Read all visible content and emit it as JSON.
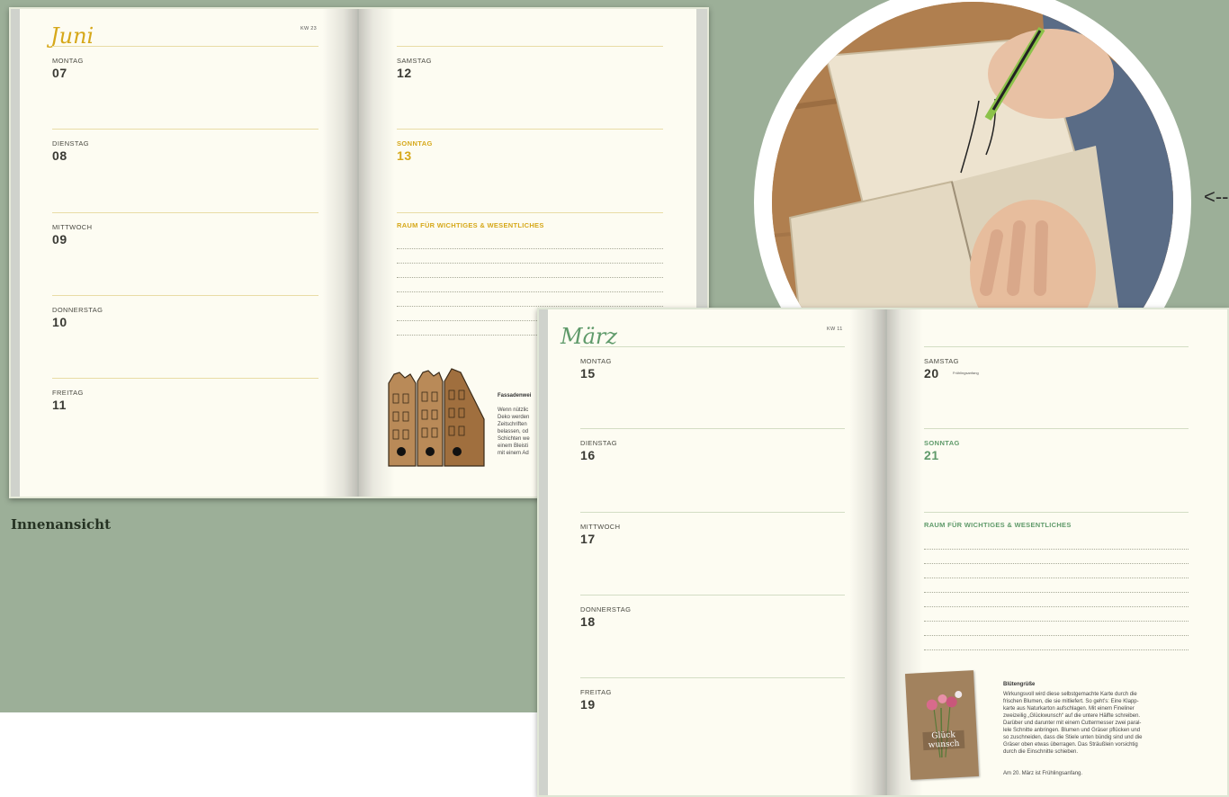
{
  "caption": "Innenansicht",
  "arrow_glyph": "<--",
  "dash_glyph": "---",
  "spread_june": {
    "month_script": "Juni",
    "kw": "KW 23",
    "left_days": [
      {
        "weekday": "MONTAG",
        "day": "07"
      },
      {
        "weekday": "DIENSTAG",
        "day": "08"
      },
      {
        "weekday": "MITTWOCH",
        "day": "09"
      },
      {
        "weekday": "DONNERSTAG",
        "day": "10"
      },
      {
        "weekday": "FREITAG",
        "day": "11"
      }
    ],
    "saturday": {
      "weekday": "SAMSTAG",
      "day": "12"
    },
    "sunday": {
      "weekday": "SONNTAG",
      "day": "13"
    },
    "raum_label": "RAUM FÜR WICHTIGES & WESENTLICHES",
    "tip_title": "Fassadenwei",
    "tip_lines": [
      "Wenn nützlic",
      "Deko werden",
      "Zeitschriften",
      "belassen, od",
      "Schichten we",
      "einem Bleisti",
      "mit einem Ad"
    ],
    "accent_color": "#d6a81a"
  },
  "spread_march": {
    "month_script": "März",
    "kw": "KW 11",
    "left_days": [
      {
        "weekday": "MONTAG",
        "day": "15"
      },
      {
        "weekday": "DIENSTAG",
        "day": "16"
      },
      {
        "weekday": "MITTWOCH",
        "day": "17"
      },
      {
        "weekday": "DONNERSTAG",
        "day": "18"
      },
      {
        "weekday": "FREITAG",
        "day": "19"
      }
    ],
    "saturday": {
      "weekday": "SAMSTAG",
      "day": "20",
      "note": "Frühlingsanfang"
    },
    "sunday": {
      "weekday": "SONNTAG",
      "day": "21"
    },
    "raum_label": "RAUM FÜR WICHTIGES & WESENTLICHES",
    "tip_title": "Blütengrüße",
    "tip_lines": [
      "Wirkungsvoll wird diese selbstgemachte Karte durch die",
      "frischen Blumen, die sie mitliefert. So geht’s: Eine Klapp-",
      "karte aus Naturkarton aufschlagen. Mit einem Fineliner",
      "zweizeilig „Glückwunsch“ auf die untere Hälfte schreiben.",
      "Darüber und darunter mit einem Cuttermesser zwei paral-",
      "lele Schnitte anbringen. Blumen und Gräser pflücken und",
      "so zuschneiden, dass die Stiele unten bündig sind und die",
      "Gräser oben etwas überragen. Das Sträußlein vorsichtig",
      "durch die Einschnitte schieben."
    ],
    "tip_footer": "Am 20. März ist Frühlingsanfang.",
    "card_text": "Glück wunsch",
    "accent_color": "#5f9a6a"
  },
  "colors": {
    "background_sage": "#9caf98",
    "page_cream": "#fdfcf2"
  }
}
